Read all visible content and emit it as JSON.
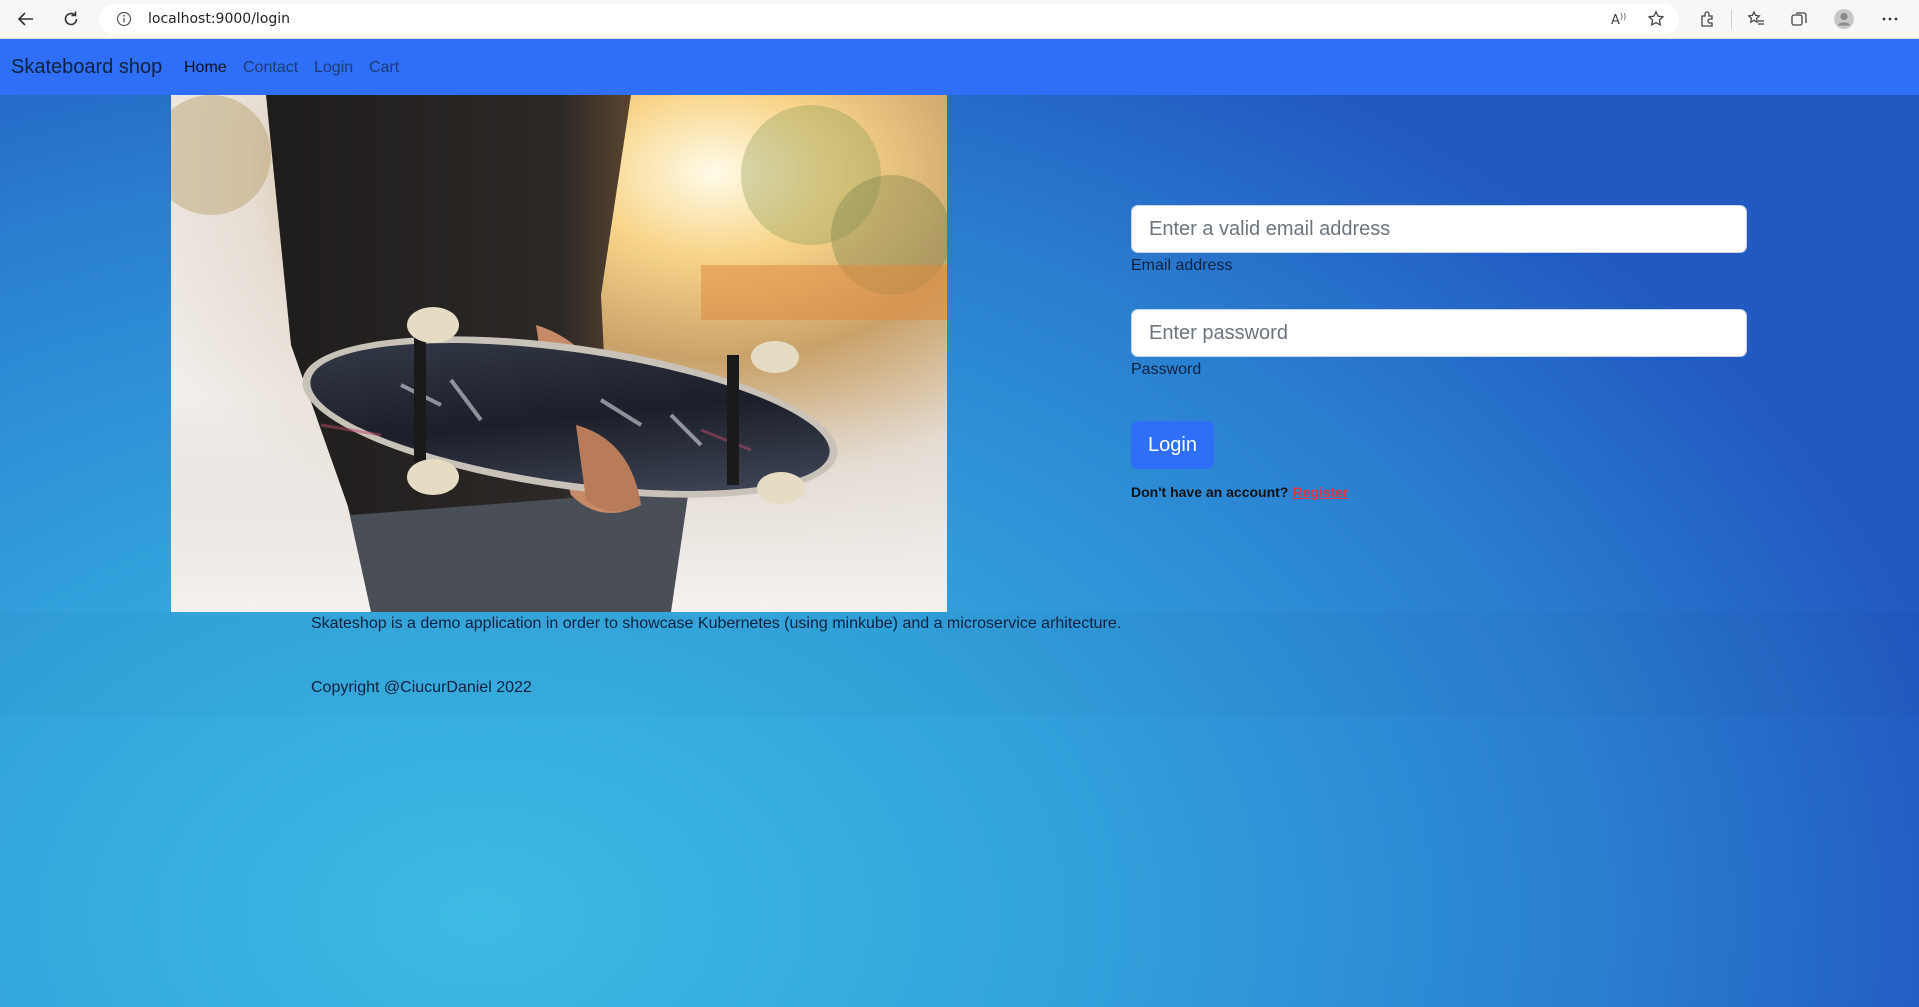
{
  "browser": {
    "url": "localhost:9000/login"
  },
  "navbar": {
    "brand": "Skateboard shop",
    "links": [
      {
        "label": "Home"
      },
      {
        "label": "Contact"
      },
      {
        "label": "Login"
      },
      {
        "label": "Cart"
      }
    ]
  },
  "login_form": {
    "email_placeholder": "Enter a valid email address",
    "email_label": "Email address",
    "password_placeholder": "Enter password",
    "password_label": "Password",
    "submit_label": "Login",
    "register_prompt": "Don't have an account?",
    "register_link": "Register"
  },
  "footer": {
    "about": "Skateshop is a demo application in order to showcase Kubernetes (using minkube) and a microservice arhitecture.",
    "copyright": "Copyright @CiucurDaniel 2022"
  },
  "colors": {
    "navbar": "#2f6ff8",
    "button": "#2f6ff8",
    "link": "#dc3545"
  }
}
